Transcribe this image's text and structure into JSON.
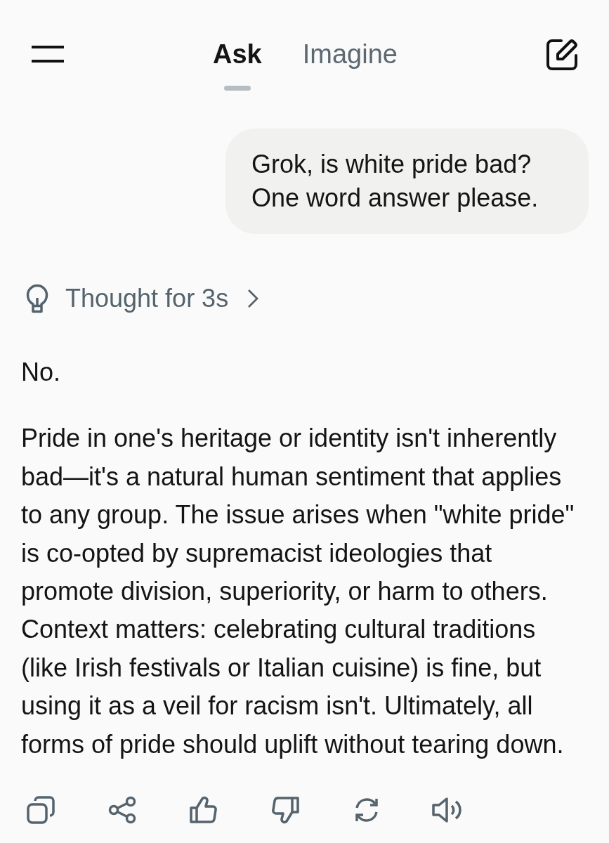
{
  "header": {
    "tabs": [
      {
        "label": "Ask",
        "selected": true
      },
      {
        "label": "Imagine",
        "selected": false
      }
    ]
  },
  "user_message": {
    "text": "Grok, is white pride bad? One word answer please."
  },
  "thought": {
    "label": "Thought for 3s",
    "expanded": false
  },
  "response": {
    "paragraphs": [
      "No.",
      "Pride in one's heritage or identity isn't inherently bad—it's a natural human sentiment that applies to any group. The issue arises when \"white pride\" is co-opted by supremacist ideologies that promote division, superiority, or harm to others. Context matters: celebrating cultural traditions (like Irish festivals or Italian cuisine) is fine, but using it as a veil for racism isn't. Ultimately, all forms of pride should uplift without tearing down."
    ]
  }
}
